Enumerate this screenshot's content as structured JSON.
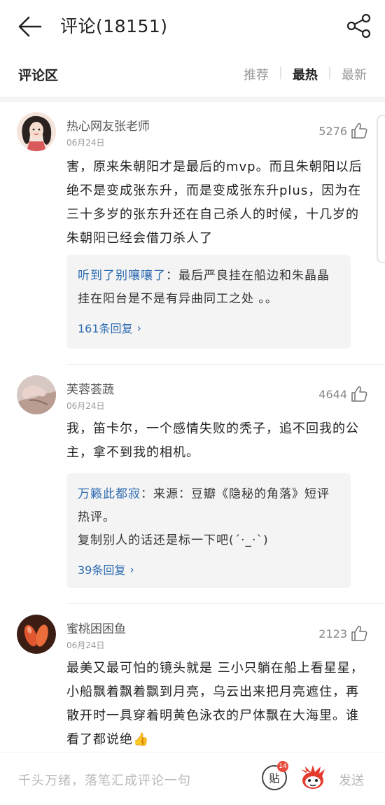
{
  "header": {
    "title": "评论(18151)"
  },
  "subbar": {
    "label": "评论区",
    "sort_options": [
      "推荐",
      "最热",
      "最新"
    ],
    "active_sort": "最热"
  },
  "comments": [
    {
      "username": "热心网友张老师",
      "date": "06月24日",
      "likes": "5276",
      "text": "害，原来朱朝阳才是最后的mvp。而且朱朝阳以后绝不是变成张东升，而是变成张东升plus，因为在三十多岁的张东升还在自己杀人的时候，十几岁的朱朝阳已经会借刀杀人了",
      "reply": {
        "user": "听到了别嚷嚷了",
        "text": "：最后严良挂在船边和朱晶晶挂在阳台是不是有异曲同工之处 。。",
        "count": "161条回复"
      }
    },
    {
      "username": "芙蓉荟蔬",
      "date": "06月24日",
      "likes": "4644",
      "text": "我，笛卡尔，一个感情失败的秃子，追不回我的公主，拿不到我的相机。",
      "reply": {
        "user": "万籁此都寂",
        "text": "：来源：豆瓣《隐秘的角落》短评热评。",
        "text2": "复制别人的话还是标一下吧(´·_·`)",
        "count": "39条回复"
      }
    },
    {
      "username": "蜜桃困困鱼",
      "date": "06月24日",
      "likes": "2123",
      "text": "最美又最可怕的镜头就是 三小只躺在船上看星星，小船飘着飘着飘到月亮，乌云出来把月亮遮住，再散开时一具穿着明黄色泳衣的尸体飘在大海里。谁看了都说绝👍"
    }
  ],
  "input_bar": {
    "placeholder": "千头万绪，落笔汇成评论一句",
    "tie_label": "贴",
    "tie_badge": "14",
    "send_label": "发送"
  },
  "colors": {
    "link": "#2c6ab0",
    "badge": "#e84a3c"
  }
}
